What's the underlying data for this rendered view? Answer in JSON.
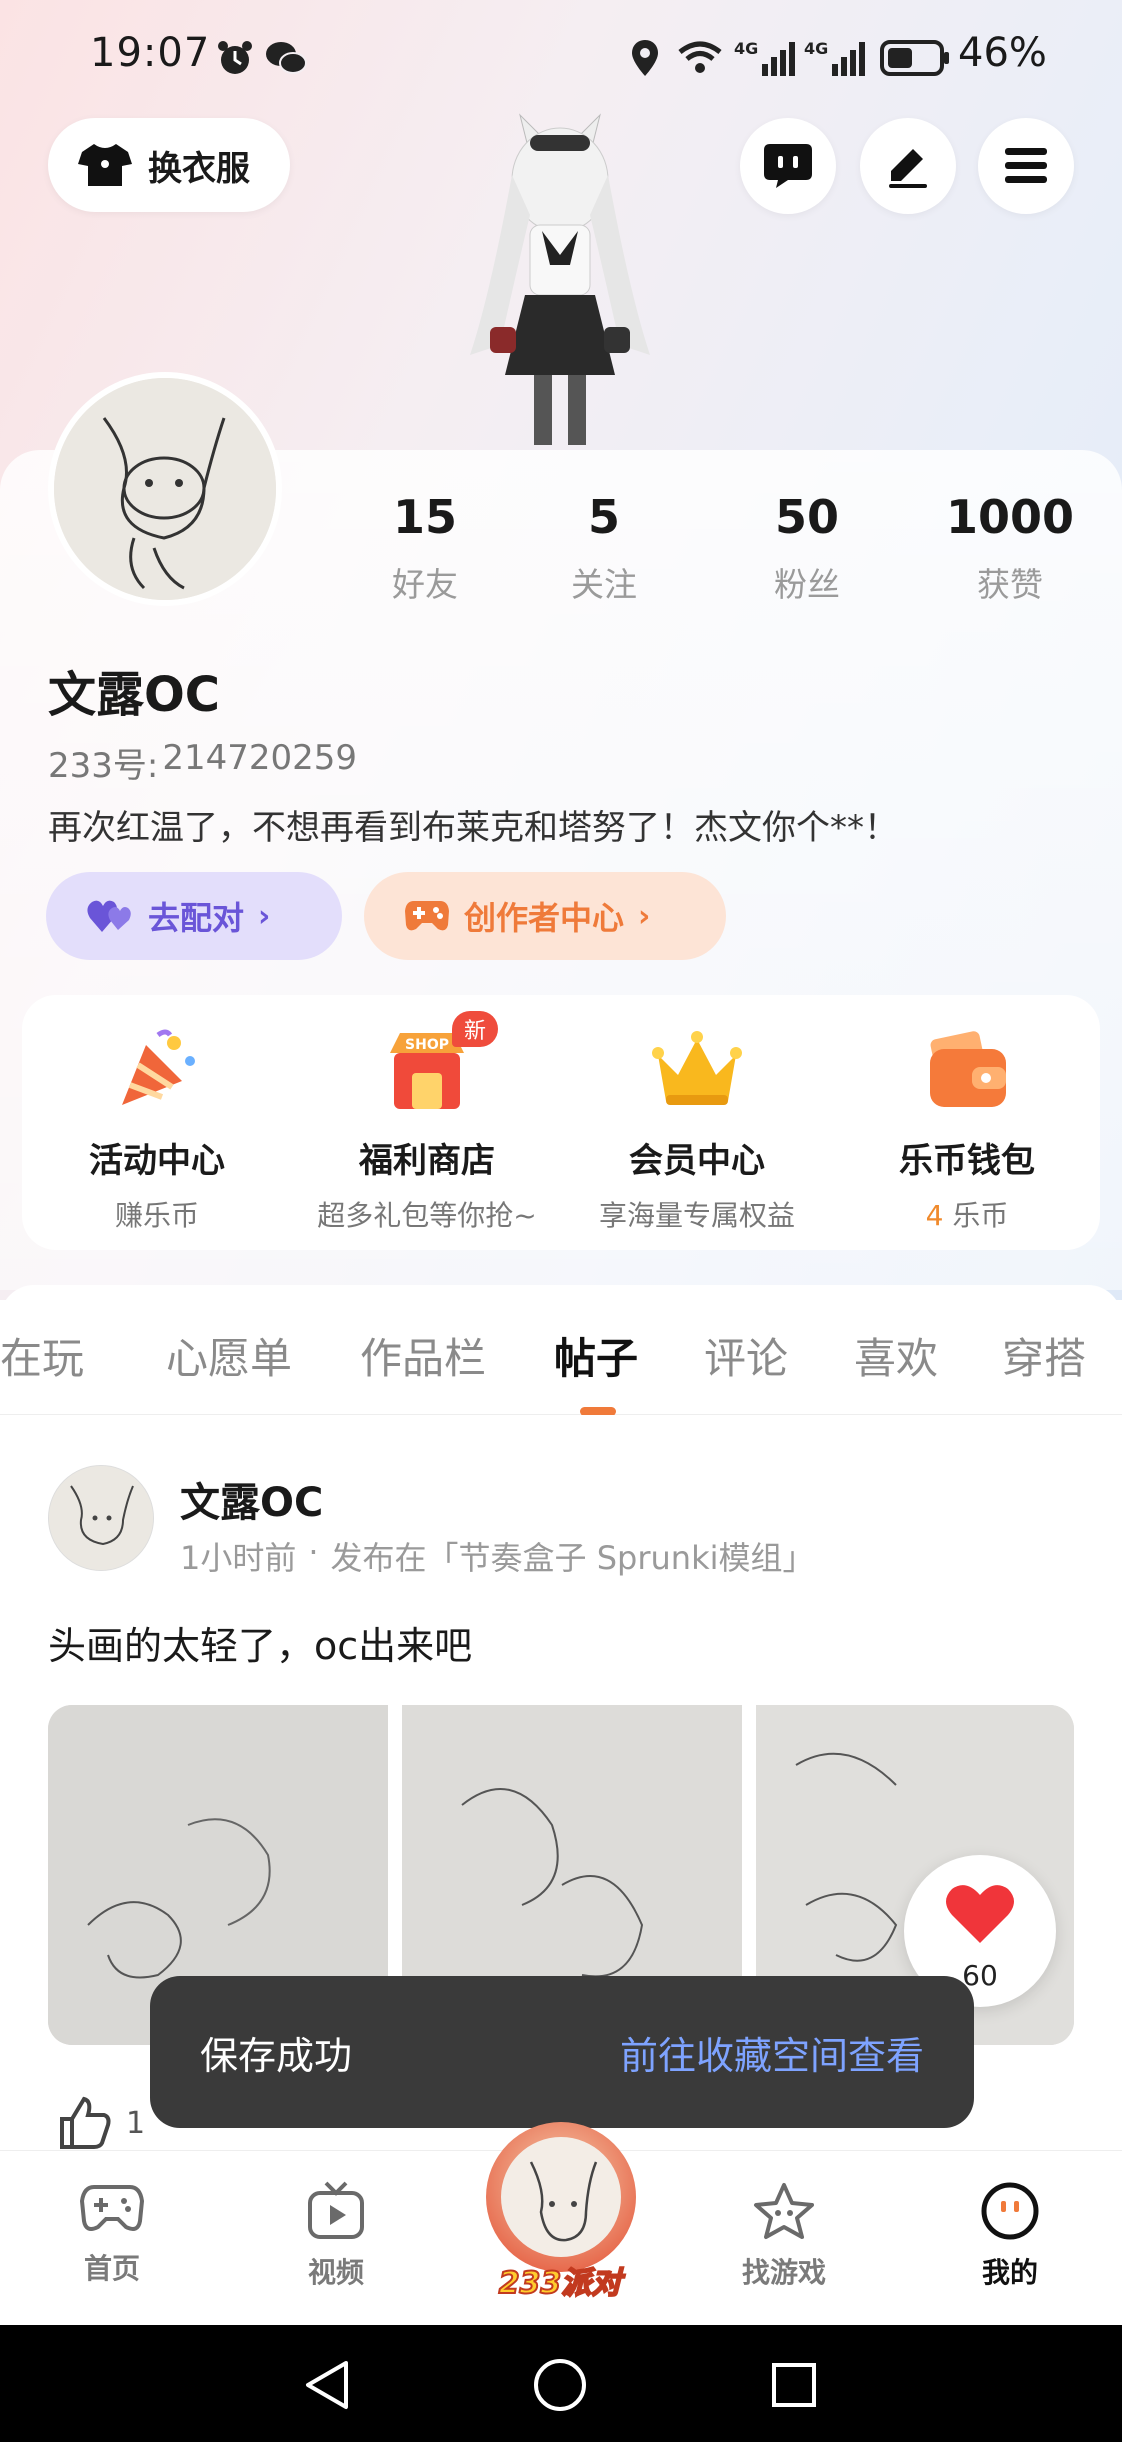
{
  "status_bar": {
    "time": "19:07",
    "battery": "46%",
    "network": "4G"
  },
  "top": {
    "outfit_label": "换衣服",
    "icons": [
      "chat-icon",
      "edit-icon",
      "menu-icon"
    ]
  },
  "profile": {
    "stats": [
      {
        "value": "15",
        "label": "好友"
      },
      {
        "value": "5",
        "label": "关注"
      },
      {
        "value": "50",
        "label": "粉丝"
      },
      {
        "value": "1000",
        "label": "获赞"
      }
    ],
    "nickname": "文露OC",
    "uid_label": "233号:",
    "uid": "214720259",
    "bio": "再次红温了，不想再看到布莱克和塔努了！杰文你个**！",
    "match_label": "去配对",
    "creator_label": "创作者中心"
  },
  "shortcuts": [
    {
      "title": "活动中心",
      "sub": "赚乐币"
    },
    {
      "title": "福利商店",
      "sub": "超多礼包等你抢~",
      "badge": "新",
      "sign": "SHOP"
    },
    {
      "title": "会员中心",
      "sub": "享海量专属权益"
    },
    {
      "title": "乐币钱包",
      "sub_num": "4",
      "sub_unit": " 乐币"
    }
  ],
  "tabs": [
    "近在玩",
    "心愿单",
    "作品栏",
    "帖子",
    "评论",
    "喜欢",
    "穿搭"
  ],
  "active_tab": "帖子",
  "post": {
    "author": "文露OC",
    "time": "1小时前",
    "location": "发布在「节奏盒子 Sprunki模组」",
    "text": "头画的太轻了，oc出来吧",
    "float_like_count": "60",
    "like_count": "1"
  },
  "toast": {
    "message": "保存成功",
    "action": "前往收藏空间查看"
  },
  "bottom_nav": {
    "items": [
      {
        "label": "首页",
        "icon": "gamepad-icon"
      },
      {
        "label": "视频",
        "icon": "video-icon"
      },
      {
        "label": "233派对",
        "icon": "party-icon"
      },
      {
        "label": "找游戏",
        "icon": "discover-game-icon"
      },
      {
        "label": "我的",
        "icon": "profile-face-icon"
      }
    ],
    "active": "我的"
  },
  "colors": {
    "accent_orange": "#f07a3a",
    "match_purple": "#6a55d8",
    "toast_link": "#7ea3ff"
  }
}
